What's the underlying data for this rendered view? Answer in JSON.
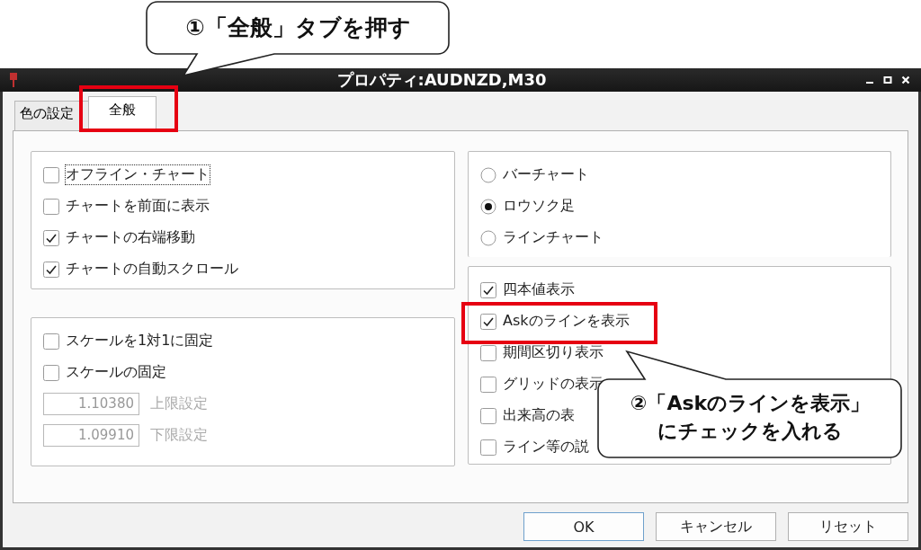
{
  "window": {
    "title": "プロパティ:AUDNZD,M30"
  },
  "tabs": [
    {
      "label": "色の設定",
      "selected": false,
      "highlighted": false
    },
    {
      "label": "全般",
      "selected": true,
      "highlighted": true
    }
  ],
  "left_groups": [
    {
      "items": [
        {
          "kind": "check",
          "label": "オフライン・チャート",
          "checked": false,
          "focused": true
        },
        {
          "kind": "check",
          "label": "チャートを前面に表示",
          "checked": false,
          "focused": false
        },
        {
          "kind": "check",
          "label": "チャートの右端移動",
          "checked": true,
          "focused": false
        },
        {
          "kind": "check",
          "label": "チャートの自動スクロール",
          "checked": true,
          "focused": false
        }
      ]
    },
    {
      "items": [
        {
          "kind": "check",
          "label": "スケールを1対1に固定",
          "checked": false,
          "focused": false
        },
        {
          "kind": "check",
          "label": "スケールの固定",
          "checked": false,
          "focused": false
        },
        {
          "kind": "field",
          "value": "1.10380",
          "label": "上限設定",
          "disabled": true
        },
        {
          "kind": "field",
          "value": "1.09910",
          "label": "下限設定",
          "disabled": true
        }
      ]
    }
  ],
  "chart_type": [
    {
      "label": "バーチャート",
      "selected": false
    },
    {
      "label": "ロウソク足",
      "selected": true
    },
    {
      "label": "ラインチャート",
      "selected": false
    }
  ],
  "display_options": [
    {
      "label": "四本値表示",
      "checked": true,
      "highlighted": false
    },
    {
      "label": "Askのラインを表示",
      "checked": true,
      "highlighted": true
    },
    {
      "label": "期間区切り表示",
      "checked": false,
      "highlighted": false
    },
    {
      "label": "グリッドの表示",
      "checked": false,
      "highlighted": false
    },
    {
      "label": "出来高の表",
      "checked": false,
      "highlighted": false
    },
    {
      "label": "ライン等の説",
      "checked": false,
      "highlighted": false
    }
  ],
  "buttons": [
    {
      "label": "OK",
      "default": true
    },
    {
      "label": "キャンセル",
      "default": false
    },
    {
      "label": "リセット",
      "default": false
    }
  ],
  "callouts": [
    {
      "lines": [
        "①「全般」タブを押す"
      ]
    },
    {
      "lines": [
        "②「Askのラインを表示」",
        "にチェックを入れる"
      ]
    }
  ]
}
